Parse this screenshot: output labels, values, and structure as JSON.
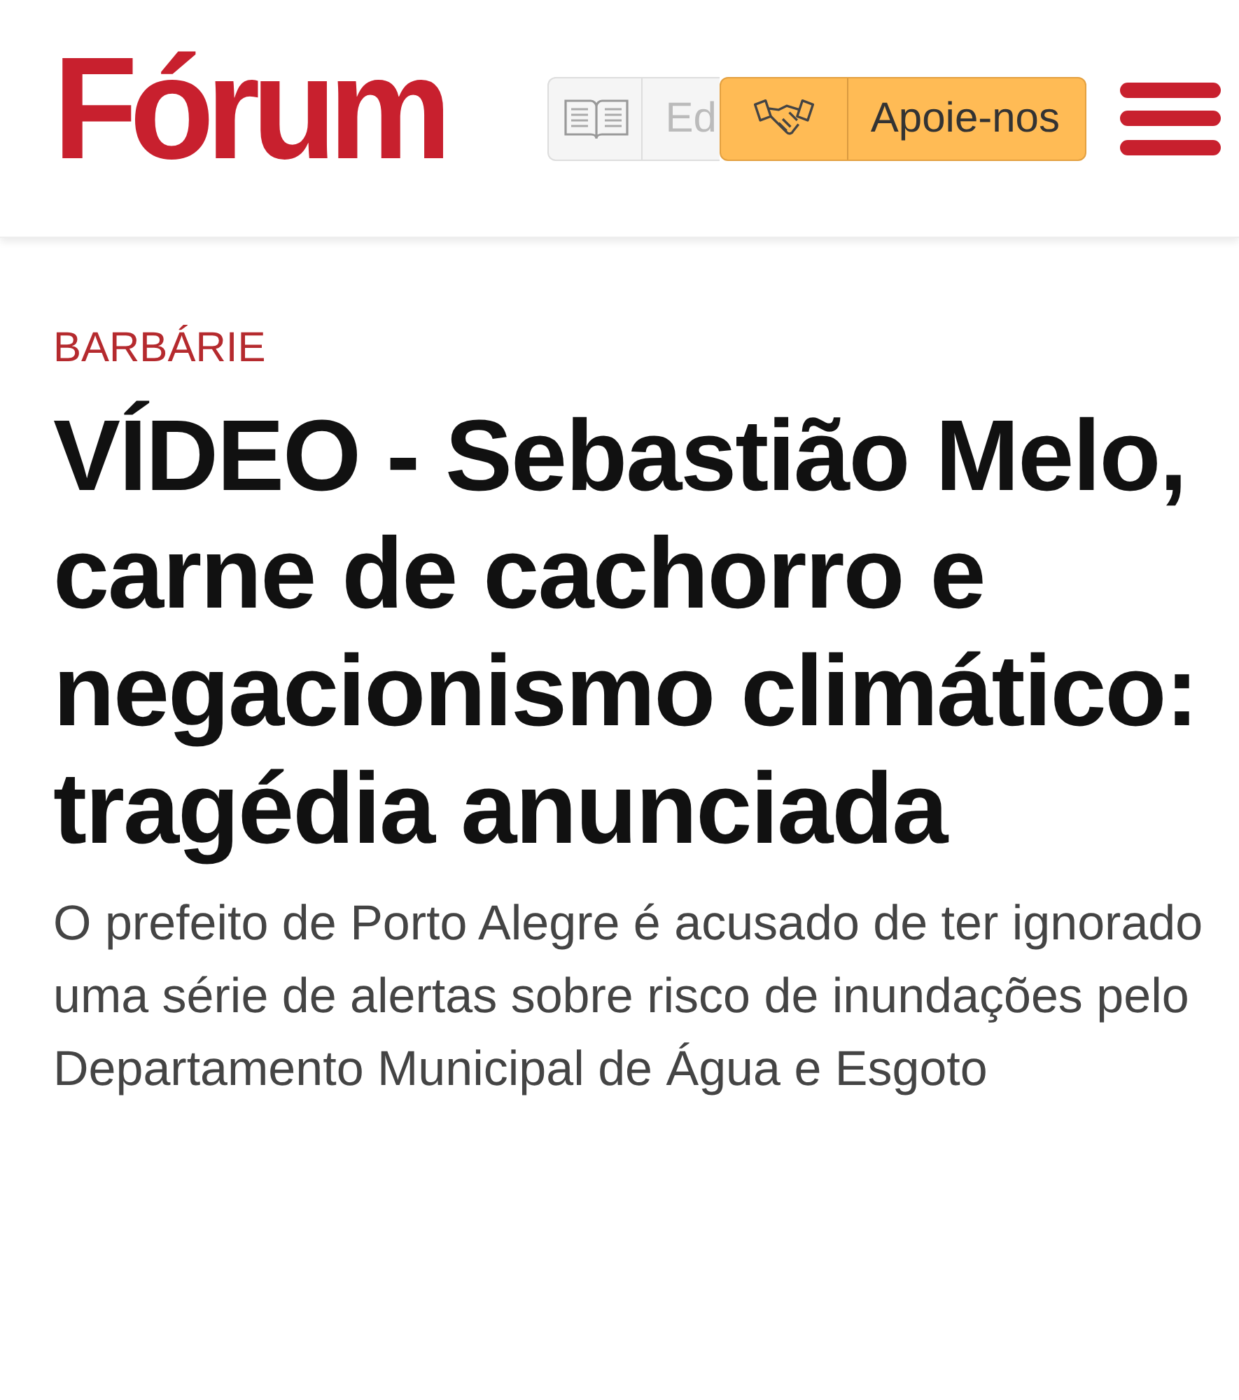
{
  "header": {
    "logo": "Fórum",
    "edition_button": {
      "label": "Ed"
    },
    "support_button": {
      "label": "Apoie-nos"
    }
  },
  "article": {
    "category": "BARBÁRIE",
    "headline": "VÍDEO - Sebastião Melo, carne de cachorro e negacionismo climático: tragédia anunciada",
    "subtitle": "O prefeito de Porto Alegre é acusado de ter ignorado uma série de alertas sobre risco de inundações pelo Departamento Municipal de Água e Esgoto"
  }
}
